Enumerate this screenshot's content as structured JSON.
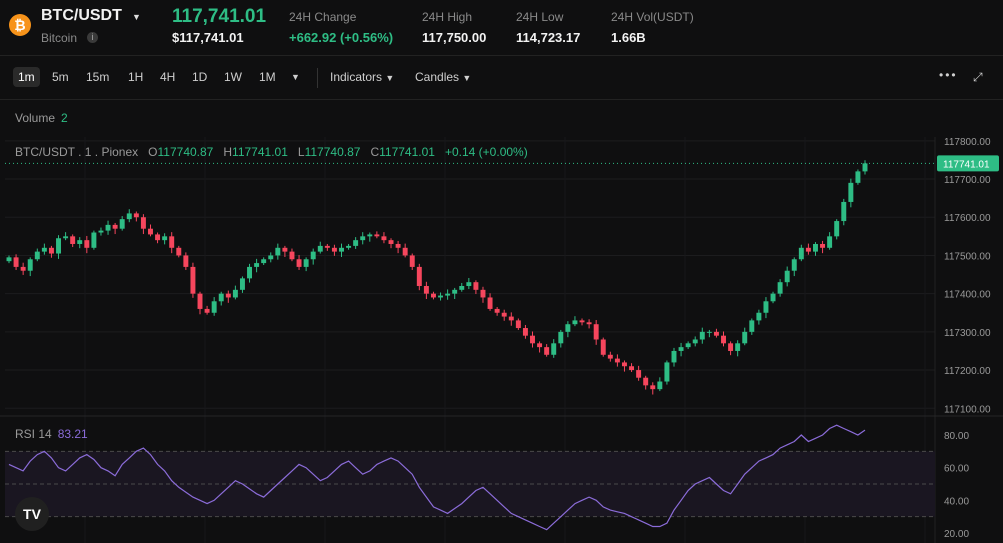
{
  "header": {
    "coin_symbol": "₿",
    "pair": "BTC/USDT",
    "coin_name": "Bitcoin",
    "last_price": "117,741.01",
    "last_price_usd": "$117,741.01",
    "stats": [
      {
        "label": "24H Change",
        "value": "+662.92 (+0.56%)",
        "positive": true
      },
      {
        "label": "24H High",
        "value": "117,750.00"
      },
      {
        "label": "24H Low",
        "value": "114,723.17"
      },
      {
        "label": "24H Vol(USDT)",
        "value": "1.66B"
      }
    ]
  },
  "toolbar": {
    "intervals": [
      "1m",
      "5m",
      "15m",
      "1H",
      "4H",
      "1D",
      "1W",
      "1M"
    ],
    "active_interval": "1m",
    "indicators_label": "Indicators",
    "candles_label": "Candles"
  },
  "volume": {
    "label": "Volume",
    "value": "2"
  },
  "legend": {
    "symbol": "BTC/USDT . 1 . Pionex",
    "o_label": "O",
    "o": "117740.87",
    "h_label": "H",
    "h": "117741.01",
    "l_label": "L",
    "l": "117740.87",
    "c_label": "C",
    "c": "117741.01",
    "change": "+0.14 (+0.00%)"
  },
  "rsi": {
    "label": "RSI 14",
    "value": "83.21",
    "ticks": [
      "80.00",
      "60.00",
      "40.00",
      "20.00"
    ]
  },
  "colors": {
    "up": "#2ebd85",
    "down": "#f6465d",
    "rsi": "#8b6cd9",
    "accent": "#2ebd85"
  },
  "chart_data": {
    "type": "candlestick",
    "y_ticks": [
      "117800.00",
      "117700.00",
      "117600.00",
      "117500.00",
      "117400.00",
      "117300.00",
      "117200.00",
      "117100.00"
    ],
    "last_price_tag": "117741.01",
    "ylim": [
      117085,
      117810
    ],
    "close_series": [
      117495,
      117470,
      117460,
      117490,
      117510,
      117520,
      117505,
      117545,
      117550,
      117530,
      117540,
      117520,
      117560,
      117565,
      117580,
      117570,
      117595,
      117610,
      117600,
      117570,
      117555,
      117540,
      117550,
      117520,
      117500,
      117470,
      117400,
      117360,
      117350,
      117380,
      117400,
      117390,
      117410,
      117440,
      117470,
      117480,
      117490,
      117500,
      117520,
      117510,
      117490,
      117470,
      117490,
      117510,
      117525,
      117520,
      117510,
      117520,
      117525,
      117540,
      117550,
      117555,
      117550,
      117540,
      117530,
      117520,
      117500,
      117470,
      117420,
      117400,
      117390,
      117395,
      117400,
      117410,
      117420,
      117430,
      117410,
      117390,
      117360,
      117350,
      117340,
      117330,
      117310,
      117290,
      117270,
      117260,
      117240,
      117270,
      117300,
      117320,
      117330,
      117325,
      117320,
      117280,
      117240,
      117230,
      117220,
      117210,
      117200,
      117180,
      117160,
      117150,
      117170,
      117220,
      117250,
      117260,
      117270,
      117280,
      117300,
      117300,
      117290,
      117270,
      117250,
      117270,
      117300,
      117330,
      117350,
      117380,
      117400,
      117430,
      117460,
      117490,
      117520,
      117510,
      117530,
      117520,
      117550,
      117590,
      117640,
      117690,
      117720,
      117741
    ],
    "rsi_series": [
      62,
      60,
      58,
      64,
      68,
      70,
      66,
      60,
      58,
      62,
      66,
      68,
      65,
      60,
      58,
      55,
      62,
      66,
      70,
      72,
      68,
      62,
      58,
      52,
      48,
      45,
      42,
      40,
      38,
      40,
      44,
      48,
      52,
      50,
      47,
      44,
      42,
      46,
      50,
      54,
      58,
      62,
      60,
      56,
      52,
      54,
      58,
      62,
      64,
      60,
      56,
      58,
      62,
      64,
      66,
      64,
      60,
      56,
      48,
      42,
      36,
      34,
      32,
      35,
      38,
      42,
      46,
      48,
      44,
      40,
      36,
      32,
      30,
      28,
      26,
      24,
      22,
      26,
      30,
      34,
      38,
      40,
      42,
      40,
      36,
      34,
      33,
      32,
      30,
      28,
      26,
      24,
      24,
      26,
      34,
      40,
      46,
      50,
      52,
      54,
      50,
      46,
      44,
      50,
      56,
      60,
      64,
      66,
      68,
      72,
      74,
      76,
      80,
      76,
      78,
      80,
      84,
      86,
      84,
      82,
      80,
      83
    ]
  }
}
